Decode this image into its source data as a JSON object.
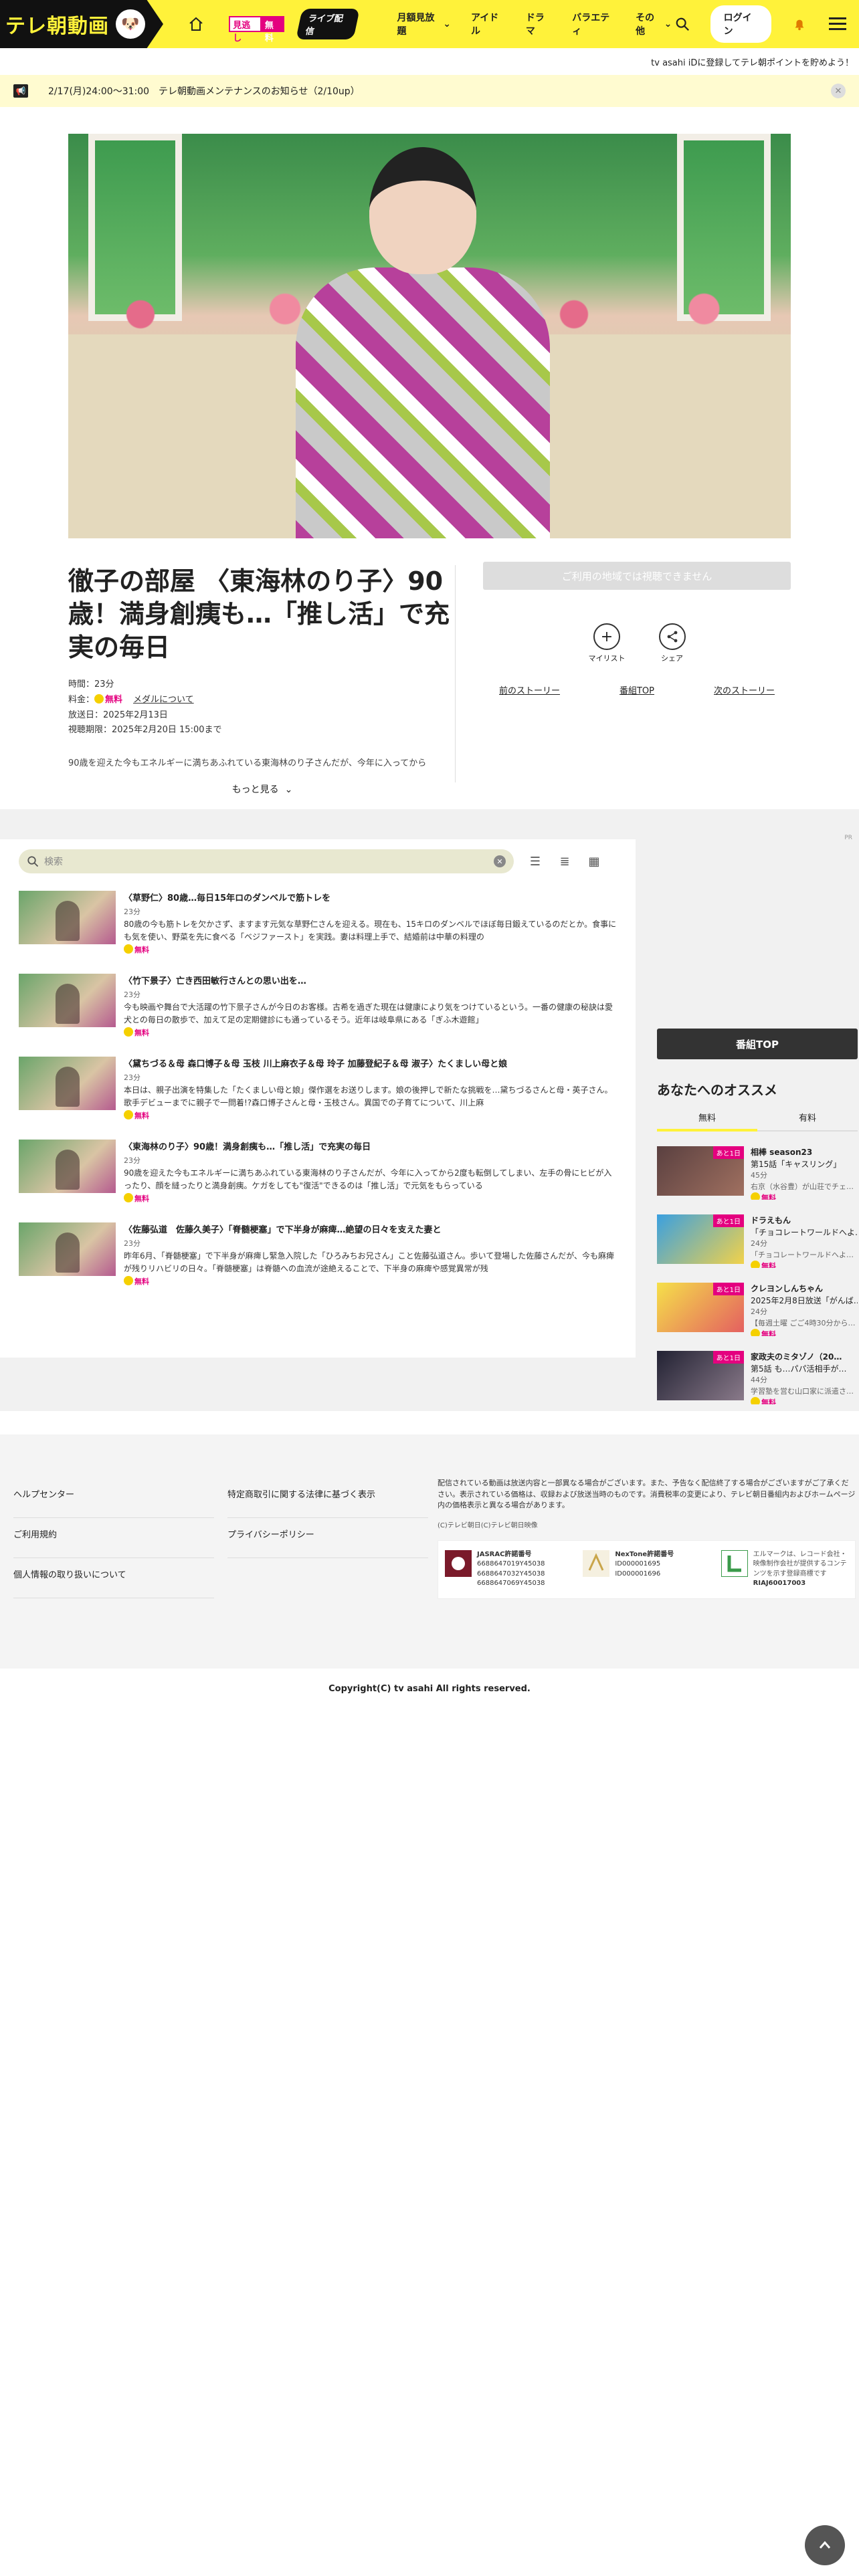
{
  "header": {
    "logo": "テレ朝動画",
    "mitoshi_a": "見逃し",
    "mitoshi_b": "無料",
    "live_badge": "ライブ配信",
    "nav": [
      "月額見放題",
      "アイドル",
      "ドラマ",
      "バラエティ",
      "その他"
    ],
    "login": "ログイン"
  },
  "tvasahi_id_text": "tv asahi iDに登録してテレ朝ポイントを貯めよう！",
  "notice": {
    "text": "2/17(月)24:00～31:00　テレ朝動画メンテナンスのお知らせ（2/10up）"
  },
  "program": {
    "title": "徹子の部屋 〈東海林のり子〉90歳！満身創痍も…「推し活」で充実の毎日",
    "duration": "時間：23分",
    "price_label": "料金：",
    "price_free": "無料",
    "medal_link": "メダルについて",
    "air_date": "放送日：2025年2月13日",
    "expire": "視聴期限：2025年2月20日 15:00まで",
    "description": "90歳を迎えた今もエネルギーに満ちあふれている東海林のり子さんだが、今年に入ってから",
    "more": "もっと見る"
  },
  "player": {
    "disabled_label": "ご利用の地域では視聴できません",
    "mylist": "マイリスト",
    "share": "シェア",
    "prev": "前のストーリー",
    "top": "番組TOP",
    "next": "次のストーリー"
  },
  "ad_label": "PR",
  "search": {
    "placeholder": "検索"
  },
  "episodes": [
    {
      "title": "〈草野仁〉80歳…毎日15年ロのダンベルで筋トレを",
      "duration": "23分",
      "desc": "80歳の今も筋トレを欠かさず、ますます元気な草野仁さんを迎える。現在も、15キロのダンベルでほぼ毎日鍛えているのだとか。食事にも気を使い、野菜を先に食べる「ベジファースト」を実践。妻は料理上手で、結婚前は中華の料理の",
      "free": "無料"
    },
    {
      "title": "〈竹下景子〉亡き西田敏行さんとの思い出を…",
      "duration": "23分",
      "desc": "今も映画や舞台で大活躍の竹下景子さんが今日のお客様。古希を過ぎた現在は健康により気をつけているという。一番の健康の秘訣は愛犬との毎日の散歩で、加えて足の定期健診にも通っているそう。近年は岐阜県にある「ぎふ木遊館」",
      "free": "無料"
    },
    {
      "title": "〈黛ちづる＆母 森口博子＆母 玉枝 川上麻衣子＆母 玲子 加藤登紀子＆母 淑子〉たくましい母と娘",
      "duration": "23分",
      "desc": "本日は、親子出演を特集した「たくましい母と娘」傑作選をお送りします。娘の後押しで新たな挑戦を…黛ちづるさんと母・英子さん。歌手デビューまでに親子で一問着!?森口博子さんと母・玉枝さん。異国での子育てについて、川上麻",
      "free": "無料"
    },
    {
      "title": "〈東海林のり子〉90歳！満身創痍も…「推し活」で充実の毎日",
      "duration": "23分",
      "desc": "90歳を迎えた今もエネルギーに満ちあふれている東海林のり子さんだが、今年に入ってから2度も転倒してしまい、左手の骨にヒビが入ったり、顔を縫ったりと満身創痍。ケガをしても\"復活\"できるのは「推し活」で元気をもらっている",
      "free": "無料"
    },
    {
      "title": "〈佐藤弘道　佐藤久美子〉「脊髄梗塞」で下半身が麻痺…絶望の日々を支えた妻と",
      "duration": "23分",
      "desc": "昨年6月、「脊髄梗塞」で下半身が麻痺し緊急入院した「ひろみちお兄さん」こと佐藤弘道さん。歩いて登場した佐藤さんだが、今も麻痺が残りリハビリの日々。「脊髄梗塞」は脊髄への血流が途絶えることで、下半身の麻痺や感覚異常が残",
      "free": "無料"
    }
  ],
  "sidebar": {
    "program_top": "番組TOP",
    "recommend_title": "あなたへのオススメ",
    "tab_free": "無料",
    "tab_paid": "有料",
    "items": [
      {
        "tag": "あと1日",
        "title": "相棒 season23",
        "sub": "第15話「キャスリング」",
        "duration": "45分",
        "desc": "右京（水谷豊）が山荘でチェ…",
        "free": "無料"
      },
      {
        "tag": "あと1日",
        "title": "ドラえもん",
        "sub": "「チョコレートワールドへよ…",
        "duration": "24分",
        "desc": "「チョコレートワールドへよ…",
        "free": "無料"
      },
      {
        "tag": "あと1日",
        "title": "クレヨンしんちゃん",
        "sub": "2025年2月8日放送「がんば…",
        "duration": "24分",
        "desc": "【毎週土曜 ごご4時30分から…",
        "free": "無料"
      },
      {
        "tag": "あと1日",
        "title": "家政夫のミタゾノ（20…",
        "sub": "第5話 も…パパ活相手が…",
        "duration": "44分",
        "desc": "学習塾を営む山口家に派遣さ…",
        "free": "無料"
      }
    ]
  },
  "footer": {
    "links": [
      "ヘルプセンター",
      "特定商取引に関する法律に基づく表示",
      "ご利用規約",
      "プライバシーポリシー",
      "個人情報の取り扱いについて"
    ],
    "note": "配信されている動画は放送内容と一部異なる場合がございます。また、予告なく配信終了する場合がございますがご了承ください。表示されている価格は、収録および放送当時のものです。消費税率の変更により、テレビ朝日番組内およびホームページ内の価格表示と異なる場合があります。",
    "small_copy": "(C)テレビ朝日(C)テレビ朝日映像",
    "licenses": [
      {
        "name": "JASRAC許諾番号",
        "lines": [
          "6688647019Y45038",
          "6688647032Y45038",
          "6688647069Y45038"
        ]
      },
      {
        "name": "NexTone許諾番号",
        "lines": [
          "ID000001695",
          "ID000001696"
        ]
      },
      {
        "name": "エルマーク",
        "lines": [
          "エルマークは、レコード会社・映像制作会社が提供するコンテンツを示す登録商標です",
          "RIAJ60017003"
        ]
      }
    ],
    "copyright": "Copyright(C) tv asahi All rights reserved."
  }
}
